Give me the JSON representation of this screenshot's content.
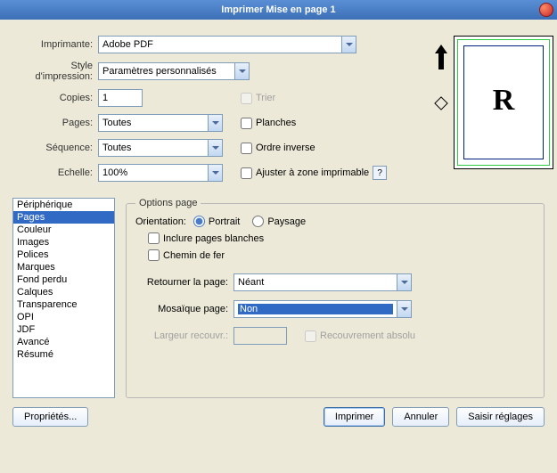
{
  "title": "Imprimer Mise en page 1",
  "labels": {
    "imprimante": "Imprimante:",
    "style": "Style d'impression:",
    "copies": "Copies:",
    "pages": "Pages:",
    "sequence": "Séquence:",
    "echelle": "Echelle:",
    "trier": "Trier",
    "planches": "Planches",
    "ordre_inverse": "Ordre inverse",
    "ajuster": "Ajuster à zone imprimable",
    "help": "?"
  },
  "values": {
    "imprimante": "Adobe PDF",
    "style": "Paramètres personnalisés",
    "copies": "1",
    "pages": "Toutes",
    "sequence": "Toutes",
    "echelle": "100%"
  },
  "preview_letter": "R",
  "list": {
    "items": [
      "Périphérique",
      "Pages",
      "Couleur",
      "Images",
      "Polices",
      "Marques",
      "Fond perdu",
      "Calques",
      "Transparence",
      "OPI",
      "JDF",
      "Avancé",
      "Résumé"
    ],
    "selected_index": 1
  },
  "options": {
    "legend": "Options page",
    "orientation_label": "Orientation:",
    "portrait": "Portrait",
    "paysage": "Paysage",
    "incl_blanches": "Inclure pages blanches",
    "chemin_fer": "Chemin de fer",
    "retourner_label": "Retourner la page:",
    "retourner_value": "Néant",
    "mosaique_label": "Mosaïque page:",
    "mosaique_value": "Non",
    "largeur_label": "Largeur recouvr.:",
    "recouvrement": "Recouvrement absolu"
  },
  "footer": {
    "proprietes": "Propriétés...",
    "imprimer": "Imprimer",
    "annuler": "Annuler",
    "saisir": "Saisir réglages"
  }
}
